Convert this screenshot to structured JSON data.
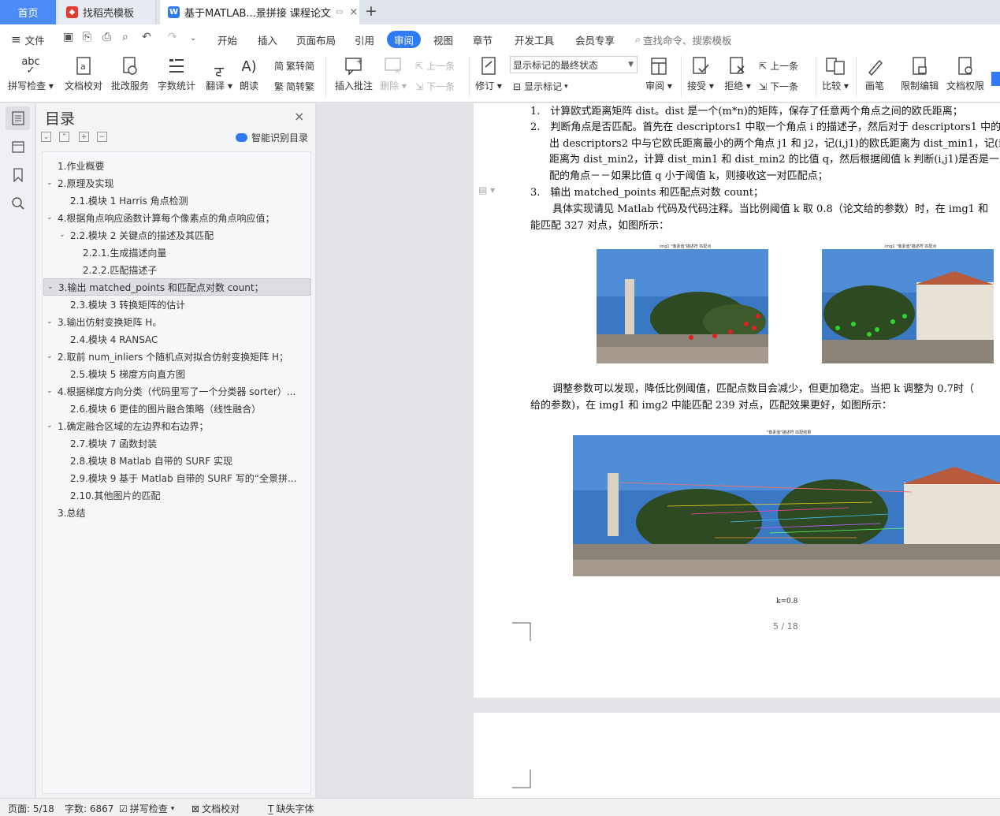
{
  "tabs": {
    "home": "首页",
    "template": "找稻壳模板",
    "doc": "基于MATLAB...景拼接 课程论文"
  },
  "menu": {
    "file": "文件",
    "items": [
      "开始",
      "插入",
      "页面布局",
      "引用",
      "审阅",
      "视图",
      "章节",
      "开发工具",
      "会员专享"
    ],
    "search": "查找命令、搜索模板"
  },
  "toolbar": {
    "spell": "拼写检查",
    "proof": "文档校对",
    "batch": "批改服务",
    "wordcount": "字数统计",
    "translate": "翻译",
    "read": "朗读",
    "to_simplified": "繁转简",
    "to_traditional": "简转繁",
    "insert_comment": "插入批注",
    "delete": "删除",
    "prev": "上一条",
    "next": "下一条",
    "revise": "修订",
    "markup_state": "显示标记的最终状态",
    "show_markup": "显示标记",
    "review": "审阅",
    "accept": "接受",
    "reject": "拒绝",
    "prev2": "上一条",
    "next2": "下一条",
    "compare": "比较",
    "pen": "画笔",
    "restrict": "限制编辑",
    "doc_perm": "文档权限"
  },
  "nav_pane": {
    "title": "目录",
    "smart": "智能识别目录",
    "items": [
      {
        "text": "1.作业概要",
        "level": 1,
        "arrow": false,
        "highlight": false
      },
      {
        "text": "2.原理及实现",
        "level": 1,
        "arrow": true,
        "highlight": false
      },
      {
        "text": "2.1.模块 1 Harris 角点检测",
        "level": 2,
        "arrow": false,
        "highlight": false
      },
      {
        "text": "4.根据角点响应函数计算每个像素点的角点响应值；",
        "level": 1,
        "arrow": true,
        "highlight": false
      },
      {
        "text": "2.2.模块 2 关键点的描述及其匹配",
        "level": 2,
        "arrow": true,
        "highlight": false
      },
      {
        "text": "2.2.1.生成描述向量",
        "level": 3,
        "arrow": false,
        "highlight": false
      },
      {
        "text": "2.2.2.匹配描述子",
        "level": 3,
        "arrow": false,
        "highlight": false
      },
      {
        "text": "3.输出 matched_points 和匹配点对数 count；",
        "level": 1,
        "arrow": true,
        "highlight": true
      },
      {
        "text": "2.3.模块 3 转换矩阵的估计",
        "level": 2,
        "arrow": false,
        "highlight": false
      },
      {
        "text": "3.输出仿射变换矩阵 H。",
        "level": 1,
        "arrow": true,
        "highlight": false
      },
      {
        "text": "2.4.模块 4 RANSAC",
        "level": 2,
        "arrow": false,
        "highlight": false
      },
      {
        "text": "2.取前 num_inliers 个随机点对拟合仿射变换矩阵 H；",
        "level": 1,
        "arrow": true,
        "highlight": false
      },
      {
        "text": "2.5.模块 5 梯度方向直方图",
        "level": 2,
        "arrow": false,
        "highlight": false
      },
      {
        "text": "4.根据梯度方向分类（代码里写了一个分类器 sorter）...",
        "level": 1,
        "arrow": true,
        "highlight": false
      },
      {
        "text": "2.6.模块 6 更佳的图片融合策略（线性融合）",
        "level": 2,
        "arrow": false,
        "highlight": false
      },
      {
        "text": "1.确定融合区域的左边界和右边界；",
        "level": 1,
        "arrow": true,
        "highlight": false
      },
      {
        "text": "2.7.模块 7 函数封装",
        "level": 2,
        "arrow": false,
        "highlight": false
      },
      {
        "text": "2.8.模块 8 Matlab 自带的 SURF 实现",
        "level": 2,
        "arrow": false,
        "highlight": false
      },
      {
        "text": "2.9.模块 9 基于 Matlab 自带的 SURF 写的“全景拼...",
        "level": 2,
        "arrow": false,
        "highlight": false
      },
      {
        "text": "2.10.其他图片的匹配",
        "level": 2,
        "arrow": false,
        "highlight": false
      },
      {
        "text": "3.总结",
        "level": 1,
        "arrow": false,
        "highlight": false
      }
    ]
  },
  "document": {
    "lines": [
      "1.　计算欧式距离矩阵 dist。dist 是一个(m*n)的矩阵，保存了任意两个角点之间的欧氏距离；",
      "2.　判断角点是否匹配。首先在 descriptors1 中取一个角点 i 的描述子，然后对于 descriptors1 中的角",
      "出 descriptors2 中与它欧氏距离最小的两个角点 j1 和 j2，记(i,j1)的欧氏距离为 dist_min1，记(i,j",
      "距离为 dist_min2，计算 dist_min1 和 dist_min2 的比值 q，然后根据阈值 k 判断(i,j1)是否是一对",
      "配的角点－－如果比值 q 小于阈值 k，则接收这一对匹配点；",
      "3.　输出 matched_points 和匹配点对数 count；",
      "具体实现请见 Matlab 代码及代码注释。当比例阈值 k 取 0.8（论文给的参数）时，在 img1 和",
      "能匹配 327 对点，如图所示：",
      "调整参数可以发现，降低比例阈值，匹配点数目会减少，但更加稳定。当把 k 调整为 0.7时（",
      "给的参数)，在 img1 和 img2 中能匹配 239 对点，匹配效果更好，如图所示："
    ],
    "fig1_caption_left": "img1 \"像素值\"描述符 匹配点",
    "fig1_caption_right": "img1 \"像素值\"描述符 匹配点",
    "fig2_caption": "\"像素值\"描述符 匹配结果",
    "k_label": "k=0.8",
    "page_number": "5 / 18"
  },
  "status": {
    "page": "页面: 5/18",
    "words": "字数: 6867",
    "spell": "拼写检查",
    "proof": "文档校对",
    "missing_font": "缺失字体"
  },
  "colors": {
    "accent": "#2f7bf6",
    "home_tab": "#4b8bf5",
    "highlight": "#dcdee2"
  }
}
